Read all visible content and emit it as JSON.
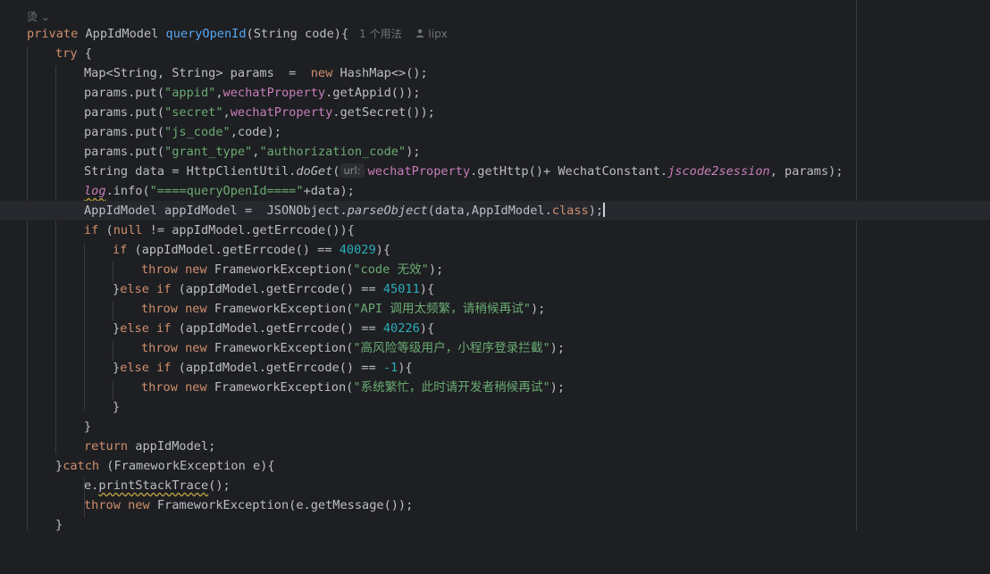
{
  "editor": {
    "top_glyph": "烫",
    "usage_hint": "1 个用法",
    "author": "lipx",
    "param_hint": "url:",
    "lines": {
      "l1": {
        "a": "private",
        "b": " AppIdModel ",
        "c": "queryOpenId",
        "d": "(String code){"
      },
      "l2": {
        "a": "try",
        "b": " {"
      },
      "l3": {
        "a": "Map<String, String> params  =  ",
        "b": "new",
        "c": " HashMap<>();"
      },
      "l4": {
        "a": "params.put(",
        "b": "\"appid\"",
        "c": ",",
        "d": "wechatProperty",
        "e": ".getAppid());"
      },
      "l5": {
        "a": "params.put(",
        "b": "\"secret\"",
        "c": ",",
        "d": "wechatProperty",
        "e": ".getSecret());"
      },
      "l6": {
        "a": "params.put(",
        "b": "\"js_code\"",
        "c": ",code);"
      },
      "l7": {
        "a": "params.put(",
        "b": "\"grant_type\"",
        "c": ",",
        "d": "\"authorization_code\"",
        "e": ");"
      },
      "l8": {
        "a": "String data = HttpClientUtil.",
        "b": "doGet",
        "c": "(",
        "d": "wechatProperty",
        "e": ".getHttp()+ WechatConstant.",
        "f": "jscode2session",
        "g": ", params);"
      },
      "l9": {
        "a": "log",
        "b": ".info(",
        "c": "\"====queryOpenId====\"",
        "d": "+data);"
      },
      "l10": {
        "a": "AppIdModel appIdModel =  JSONObject.",
        "b": "parseObject",
        "c": "(data,AppIdModel.",
        "d": "class",
        "e": ");"
      },
      "l11": {
        "a": "if",
        "b": " (",
        "c": "null",
        "d": " != appIdModel.getErrcode()){"
      },
      "l12": {
        "a": "if",
        "b": " (appIdModel.getErrcode() == ",
        "c": "40029",
        "d": "){"
      },
      "l13": {
        "a": "throw",
        "b": " ",
        "c": "new",
        "d": " FrameworkException(",
        "e": "\"code 无效\"",
        "f": ");"
      },
      "l14": {
        "a": "}",
        "b": "else",
        "c": " ",
        "d": "if",
        "e": " (appIdModel.getErrcode() == ",
        "f": "45011",
        "g": "){"
      },
      "l15": {
        "a": "throw",
        "b": " ",
        "c": "new",
        "d": " FrameworkException(",
        "e": "\"API 调用太频繁，请稍候再试\"",
        "f": ");"
      },
      "l16": {
        "a": "}",
        "b": "else",
        "c": " ",
        "d": "if",
        "e": " (appIdModel.getErrcode() == ",
        "f": "40226",
        "g": "){"
      },
      "l17": {
        "a": "throw",
        "b": " ",
        "c": "new",
        "d": " FrameworkException(",
        "e": "\"高风险等级用户，小程序登录拦截\"",
        "f": ");"
      },
      "l18": {
        "a": "}",
        "b": "else",
        "c": " ",
        "d": "if",
        "e": " (appIdModel.getErrcode() == ",
        "f": "-1",
        "g": "){"
      },
      "l19": {
        "a": "throw",
        "b": " ",
        "c": "new",
        "d": " FrameworkException(",
        "e": "\"系统繁忙，此时请开发者稍候再试\"",
        "f": ");"
      },
      "l20": {
        "a": "}"
      },
      "l21": {
        "a": "}"
      },
      "l22": {
        "a": "return",
        "b": " appIdModel;"
      },
      "l23": {
        "a": "}",
        "b": "catch",
        "c": " (FrameworkException e){"
      },
      "l24": {
        "a": "e.",
        "b": "printStackTrace",
        "c": "();"
      },
      "l25": {
        "a": "throw",
        "b": " ",
        "c": "new",
        "d": " FrameworkException(e.getMessage());"
      },
      "l26": {
        "a": "}"
      }
    }
  },
  "colors": {
    "background": "#1e1f22",
    "keyword": "#cf8e6d",
    "method_declaration": "#56a8f5",
    "field": "#c77dbb",
    "string": "#6aab73",
    "number": "#2aacb8"
  }
}
